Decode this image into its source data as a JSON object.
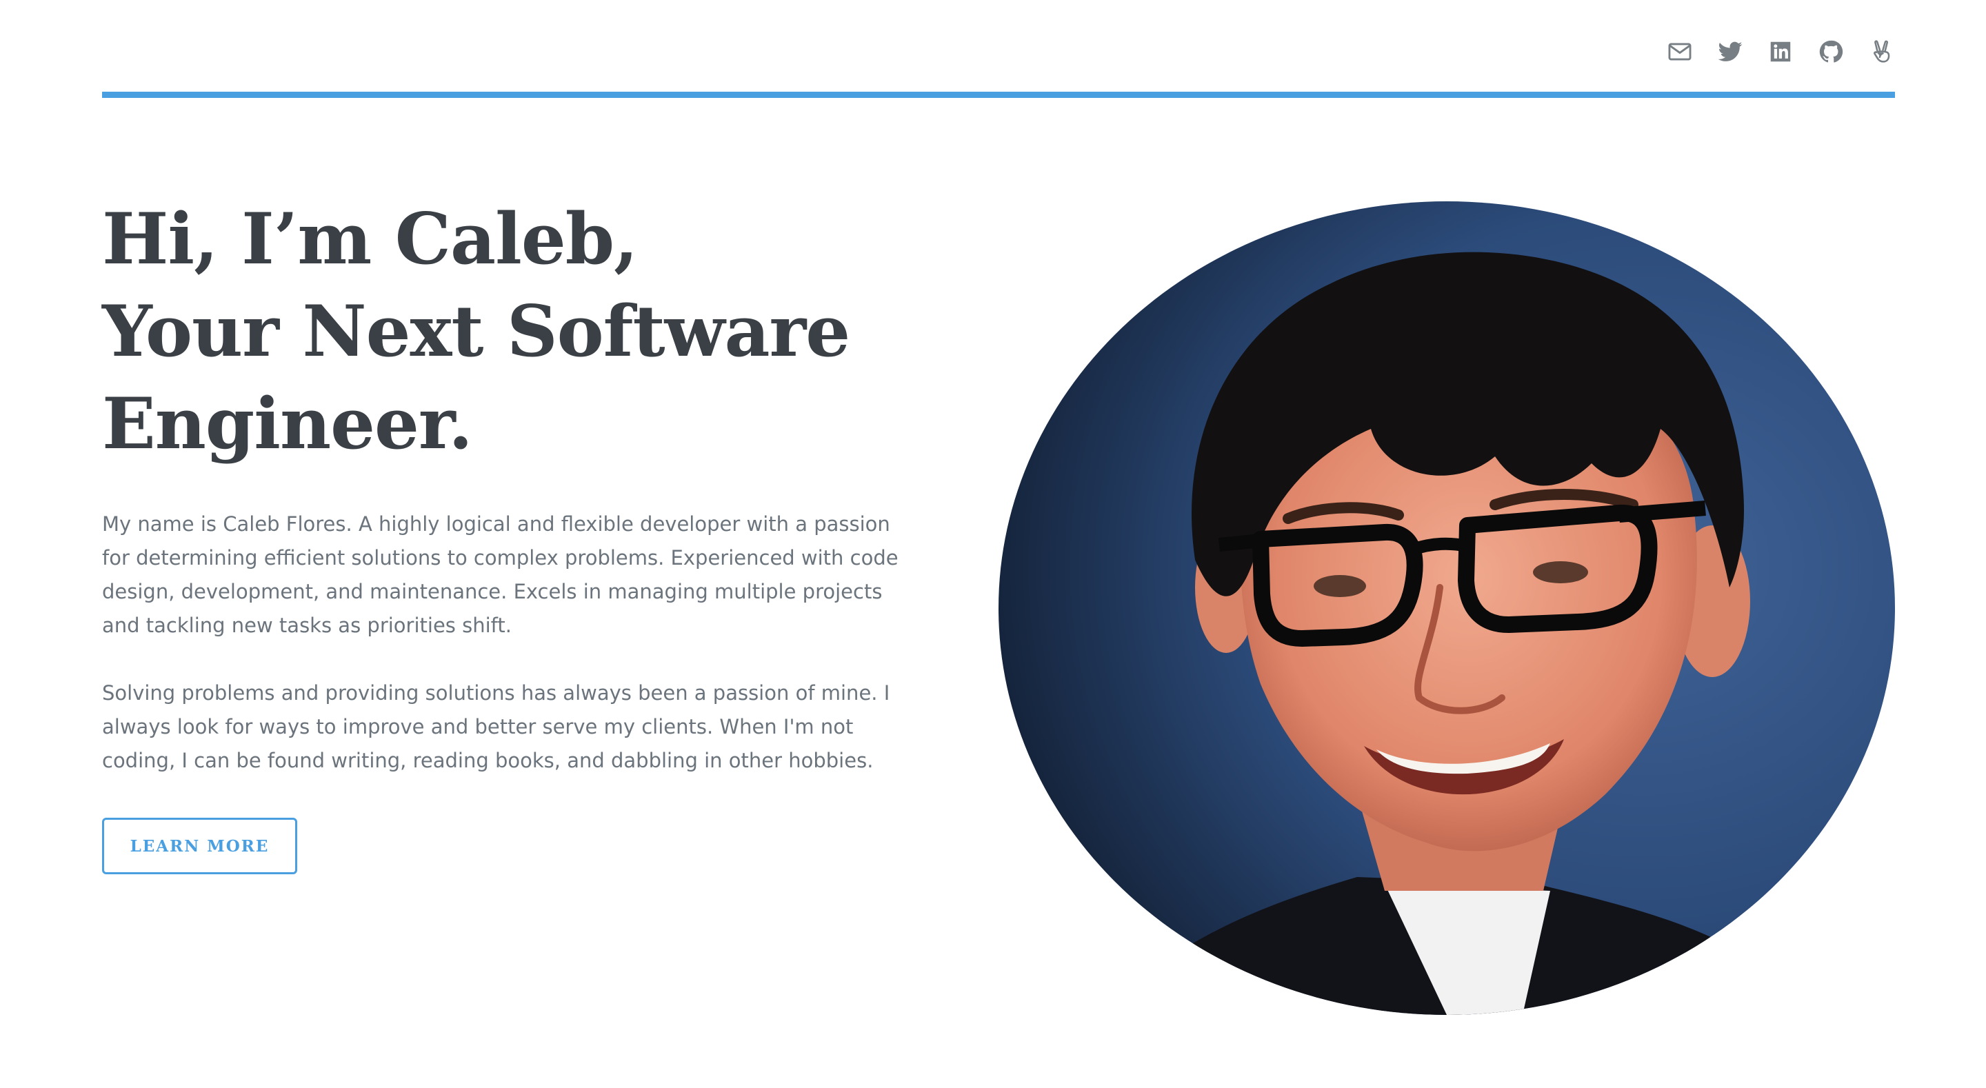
{
  "theme": {
    "accent": "#4a9fe0",
    "heading_color": "#3a4045",
    "body_color": "#6b747c",
    "icon_color": "#777e84"
  },
  "social": {
    "items": [
      {
        "icon": "envelope-icon",
        "label": "Email"
      },
      {
        "icon": "twitter-icon",
        "label": "Twitter"
      },
      {
        "icon": "linkedin-icon",
        "label": "LinkedIn"
      },
      {
        "icon": "github-icon",
        "label": "GitHub"
      },
      {
        "icon": "angellist-icon",
        "label": "AngelList"
      }
    ]
  },
  "hero": {
    "title_lines": [
      "Hi, I’m Caleb,",
      "Your Next Software",
      "Engineer."
    ],
    "bio_1": "My name is Caleb Flores. A highly logical and flexible developer with a passion for determining efficient solutions to complex problems. Experienced with code design, development, and maintenance. Excels in managing multiple projects and tackling new tasks as priorities shift.",
    "bio_2": "Solving problems and providing solutions has always been a passion of mine. I always look for ways to improve and better serve my clients. When I'm not coding, I can be found writing, reading books, and dabbling in other hobbies.",
    "cta_label": "LEARN MORE"
  },
  "portrait": {
    "description_icon": "profile-photo"
  }
}
